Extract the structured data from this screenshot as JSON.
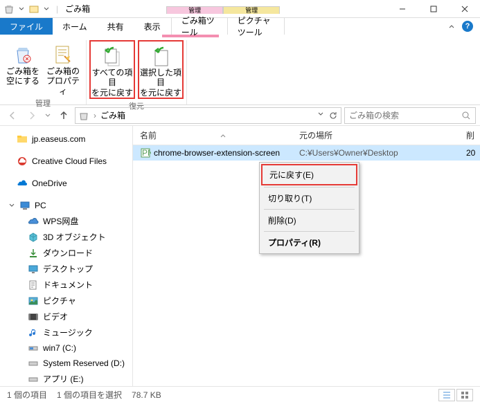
{
  "title": "ごみ箱",
  "contextual_tabs": {
    "manage1": {
      "head": "管理",
      "label": "ごみ箱ツール"
    },
    "manage2": {
      "head": "管理",
      "label": "ピクチャツール"
    }
  },
  "tabs": {
    "file": "ファイル",
    "home": "ホーム",
    "share": "共有",
    "view": "表示"
  },
  "ribbon": {
    "group_manage": {
      "label": "管理",
      "empty": "ごみ箱を\n空にする",
      "props": "ごみ箱の\nプロパティ"
    },
    "group_restore": {
      "label": "復元",
      "all": "すべての項目\nを元に戻す",
      "selected": "選択した項目\nを元に戻す"
    }
  },
  "address": {
    "location": "ごみ箱"
  },
  "search": {
    "placeholder": "ごみ箱の検索"
  },
  "columns": {
    "name": "名前",
    "orig": "元の場所",
    "del": "削"
  },
  "file": {
    "name": "chrome-browser-extension-screen",
    "orig": "C:¥Users¥Owner¥Desktop",
    "del": "20"
  },
  "context_menu": {
    "restore": "元に戻す(E)",
    "cut": "切り取り(T)",
    "delete": "削除(D)",
    "props": "プロパティ(R)"
  },
  "tree": {
    "easeus": "jp.easeus.com",
    "ccf": "Creative Cloud Files",
    "onedrive": "OneDrive",
    "pc": "PC",
    "wps": "WPS网盘",
    "3d": "3D オブジェクト",
    "dl": "ダウンロード",
    "desktop": "デスクトップ",
    "docs": "ドキュメント",
    "pics": "ピクチャ",
    "video": "ビデオ",
    "music": "ミュージック",
    "win7": "win7 (C:)",
    "sysres": "System Reserved (D:)",
    "apps": "アプリ (E:)"
  },
  "status": {
    "count": "1 個の項目",
    "selected": "1 個の項目を選択",
    "size": "78.7 KB"
  }
}
